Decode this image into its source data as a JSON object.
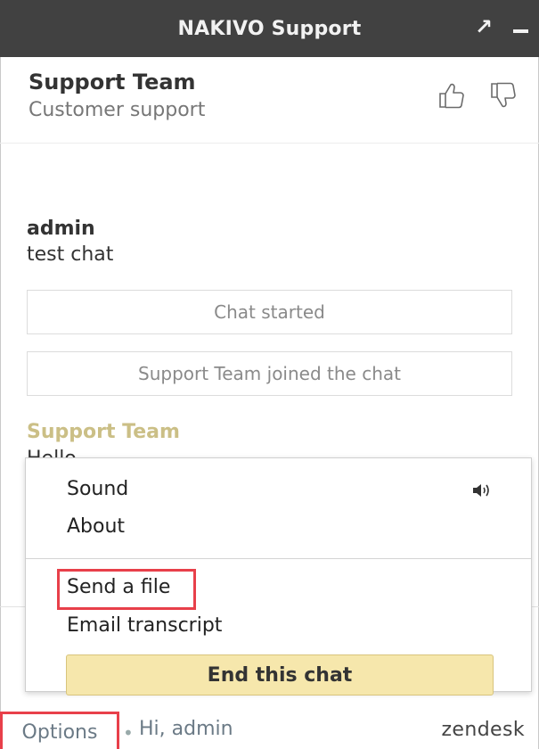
{
  "titlebar": {
    "title": "NAKIVO Support",
    "popout_icon": "popout-arrow-icon",
    "minimize_icon": "minimize-icon"
  },
  "agent": {
    "name": "Support Team",
    "role": "Customer support",
    "rate_good_icon": "thumbs-up-icon",
    "rate_bad_icon": "thumbs-down-icon"
  },
  "messages": {
    "admin": {
      "from": "admin",
      "text": "test chat"
    },
    "system": [
      "Chat started",
      "Support Team joined the chat"
    ],
    "agent": {
      "from": "Support Team",
      "text": "Hello"
    }
  },
  "menu": {
    "sound_label": "Sound",
    "sound_icon": "speaker-icon",
    "about_label": "About",
    "send_file_label": "Send a file",
    "email_transcript_label": "Email transcript",
    "end_chat_label": "End this chat"
  },
  "footer": {
    "options_label": "Options",
    "separator": "•",
    "greeting": "Hi, admin",
    "brand": "zendesk"
  },
  "colors": {
    "titlebar_bg": "#414141",
    "agent_name_accent": "#cbbf86",
    "end_chat_bg": "#f6e7ac",
    "highlight_red": "#e8404a"
  }
}
